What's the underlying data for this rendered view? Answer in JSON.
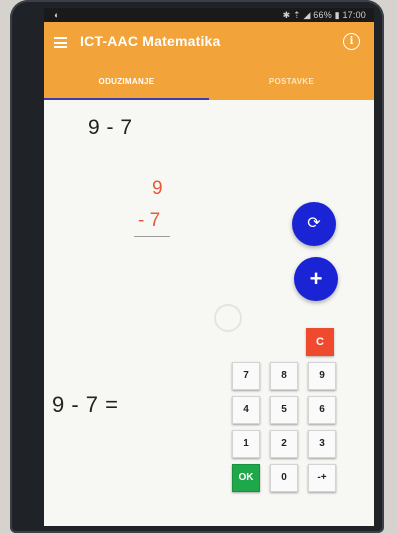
{
  "status_bar": {
    "left": "◐",
    "right": "✱ ⇡ ◢ 66% ▮ 17:00"
  },
  "app_bar": {
    "title": "ICT-AAC Matematika",
    "info_icon": "ⓘ"
  },
  "tabs": [
    {
      "label": "ODUZIMANJE",
      "active": true
    },
    {
      "label": "POSTAVKE",
      "active": false
    }
  ],
  "problem": {
    "title": "9 - 7",
    "minuend": "9",
    "subtrahend": "- 7",
    "equation": "9 - 7 ="
  },
  "fabs": {
    "refresh_icon": "⟳",
    "add_icon": "+"
  },
  "keypad": {
    "clear_label": "C",
    "rows": [
      [
        "7",
        "8",
        "9"
      ],
      [
        "4",
        "5",
        "6"
      ],
      [
        "1",
        "2",
        "3"
      ],
      [
        "OK",
        "0",
        "-+"
      ]
    ]
  },
  "colors": {
    "app_bar": "#f2a33a",
    "tab_indicator": "#3b3fa8",
    "fab": "#1a24d4",
    "clear_key": "#f04a2e",
    "ok_key": "#1ea84a",
    "digits": "#e8583a"
  }
}
